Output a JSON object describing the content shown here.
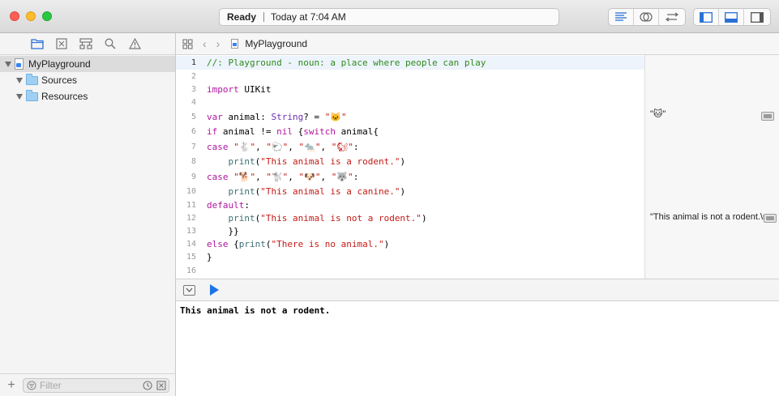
{
  "titlebar": {
    "status": "Ready",
    "timestamp": "Today at 7:04 AM",
    "editor_mode_icons": [
      "standard-editor-icon",
      "assistant-editor-icon",
      "version-editor-icon"
    ],
    "panel_icons": [
      "navigator-panel-icon",
      "debug-panel-icon",
      "utilities-panel-icon"
    ]
  },
  "navigator": {
    "tab_icons": [
      "folder-icon",
      "symbol-icon",
      "hierarchy-icon",
      "search-icon",
      "warning-icon"
    ],
    "tree": [
      {
        "label": "MyPlayground",
        "type": "playground",
        "expanded": true,
        "selected": true
      },
      {
        "label": "Sources",
        "type": "folder",
        "expanded": true
      },
      {
        "label": "Resources",
        "type": "folder",
        "expanded": true
      }
    ],
    "add_label": "+",
    "filter_placeholder": "Filter"
  },
  "jumpbar": {
    "back": "‹",
    "forward": "›",
    "file": "MyPlayground"
  },
  "editor": {
    "current_line": 1,
    "lines": [
      {
        "n": "1",
        "text": "//: Playground - noun: a place where people can play"
      },
      {
        "n": "2",
        "text": ""
      },
      {
        "n": "3",
        "text": "import UIKit"
      },
      {
        "n": "4",
        "text": ""
      },
      {
        "n": "5",
        "text": "var animal: String? = \"🐱\""
      },
      {
        "n": "6",
        "text": "if animal != nil {switch animal{"
      },
      {
        "n": "7",
        "text": "case \"🐇\", \"🐑\", \"🐀\", \"🐿\":"
      },
      {
        "n": "8",
        "text": "    print(\"This animal is a rodent.\")"
      },
      {
        "n": "9",
        "text": "case \"🐕\", \"🐩\", \"🐶\", \"🐺\":"
      },
      {
        "n": "10",
        "text": "    print(\"This animal is a canine.\")"
      },
      {
        "n": "11",
        "text": "default:"
      },
      {
        "n": "12",
        "text": "    print(\"This animal is not a rodent.\")"
      },
      {
        "n": "13",
        "text": "    }}"
      },
      {
        "n": "14",
        "text": "else {print(\"There is no animal.\")"
      },
      {
        "n": "15",
        "text": "}"
      },
      {
        "n": "16",
        "text": ""
      }
    ]
  },
  "results": {
    "line5": "\"🐱\"",
    "line12": "\"This animal is not a rodent.\\n\""
  },
  "console": {
    "output": "This animal is not a rodent."
  }
}
